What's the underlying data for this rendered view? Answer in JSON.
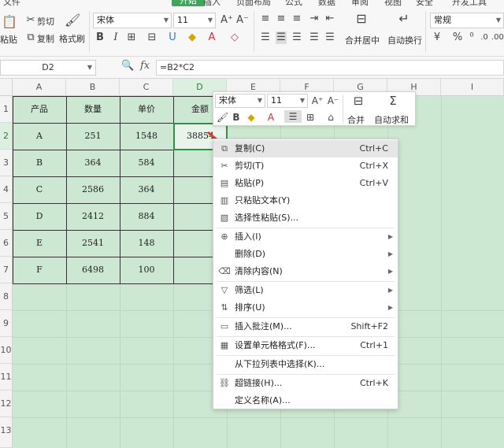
{
  "menubar": {
    "items": [
      "文件",
      "开始",
      "插入",
      "页面布局",
      "公式",
      "数据",
      "审阅",
      "视图",
      "安全",
      "开发工具"
    ],
    "active": "开始"
  },
  "ribbon": {
    "paste": "粘贴",
    "cut": "剪切",
    "copy": "复制",
    "format_painter": "格式刷",
    "font_name": "宋体",
    "font_size": "11",
    "merge_center": "合并居中",
    "wrap_text": "自动换行",
    "number_format": "常规"
  },
  "formula_bar": {
    "name_box": "D2",
    "formula": "=B2*C2",
    "fx_label": "fx"
  },
  "columns": [
    "A",
    "B",
    "C",
    "D",
    "E",
    "F",
    "G",
    "H",
    "I"
  ],
  "rows": [
    "1",
    "2",
    "3",
    "4",
    "5",
    "6",
    "7",
    "8",
    "9",
    "10",
    "11",
    "12",
    "13"
  ],
  "table": {
    "headers": [
      "产品",
      "数量",
      "单价",
      "金额"
    ],
    "rows": [
      [
        "A",
        "251",
        "1548",
        "38854"
      ],
      [
        "B",
        "364",
        "584",
        ""
      ],
      [
        "C",
        "2586",
        "364",
        ""
      ],
      [
        "D",
        "2412",
        "884",
        ""
      ],
      [
        "E",
        "2541",
        "148",
        ""
      ],
      [
        "F",
        "6498",
        "100",
        ""
      ]
    ]
  },
  "mini_toolbar": {
    "font_name": "宋体",
    "font_size": "11",
    "merge_label": "合并",
    "autosum_label": "自动求和"
  },
  "context_menu": {
    "items": [
      {
        "label": "复制(C)",
        "shortcut": "Ctrl+C",
        "icon": "copy-icon",
        "highlighted": true
      },
      {
        "label": "剪切(T)",
        "shortcut": "Ctrl+X",
        "icon": "scissors-icon"
      },
      {
        "label": "粘贴(P)",
        "shortcut": "Ctrl+V",
        "icon": "paste-icon"
      },
      {
        "label": "只粘贴文本(Y)",
        "shortcut": "",
        "icon": "paste-text-icon"
      },
      {
        "label": "选择性粘贴(S)...",
        "shortcut": "",
        "icon": "paste-special-icon"
      },
      {
        "label": "插入(I)",
        "shortcut": "",
        "icon": "insert-icon",
        "submenu": true
      },
      {
        "label": "删除(D)",
        "shortcut": "",
        "icon": "",
        "submenu": true
      },
      {
        "label": "清除内容(N)",
        "shortcut": "",
        "icon": "eraser-icon",
        "submenu": true
      },
      {
        "label": "筛选(L)",
        "shortcut": "",
        "icon": "filter-icon",
        "submenu": true
      },
      {
        "label": "排序(U)",
        "shortcut": "",
        "icon": "sort-icon",
        "submenu": true
      },
      {
        "label": "插入批注(M)...",
        "shortcut": "Shift+F2",
        "icon": "comment-icon"
      },
      {
        "label": "设置单元格格式(F)...",
        "shortcut": "Ctrl+1",
        "icon": "format-cells-icon"
      },
      {
        "label": "从下拉列表中选择(K)...",
        "shortcut": "",
        "icon": ""
      },
      {
        "label": "超链接(H)...",
        "shortcut": "Ctrl+K",
        "icon": "link-icon"
      },
      {
        "label": "定义名称(A)...",
        "shortcut": "",
        "icon": ""
      }
    ]
  },
  "colors": {
    "accent": "#3fa75a",
    "grid_bg": "#cde8d2",
    "arrow": "#e23b2e"
  }
}
